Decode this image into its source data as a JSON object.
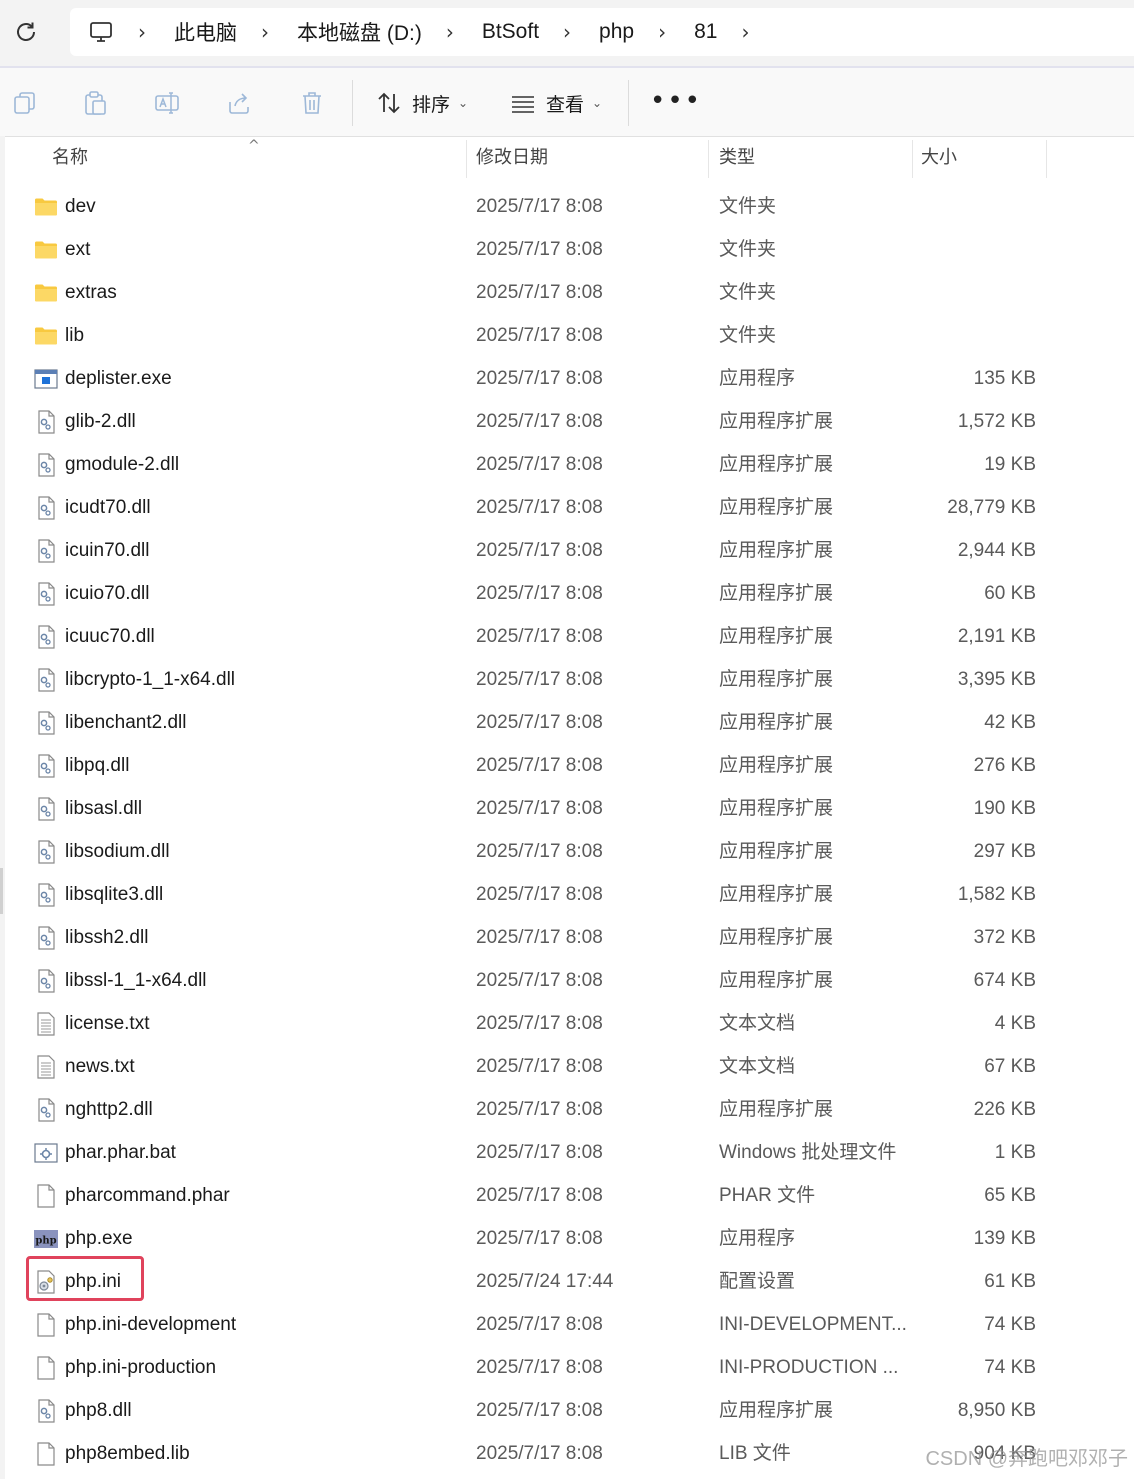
{
  "address_bar": {
    "breadcrumbs": [
      "此电脑",
      "本地磁盘 (D:)",
      "BtSoft",
      "php",
      "81"
    ],
    "separator": "›"
  },
  "toolbar": {
    "sort_label": "排序",
    "view_label": "查看",
    "more_label": "•••"
  },
  "columns": {
    "name": "名称",
    "date": "修改日期",
    "type": "类型",
    "size": "大小",
    "sort_indicator": "^"
  },
  "files": [
    {
      "name": "dev",
      "date": "2025/7/17 8:08",
      "type": "文件夹",
      "size": "",
      "icon": "folder-icon"
    },
    {
      "name": "ext",
      "date": "2025/7/17 8:08",
      "type": "文件夹",
      "size": "",
      "icon": "folder-icon"
    },
    {
      "name": "extras",
      "date": "2025/7/17 8:08",
      "type": "文件夹",
      "size": "",
      "icon": "folder-icon"
    },
    {
      "name": "lib",
      "date": "2025/7/17 8:08",
      "type": "文件夹",
      "size": "",
      "icon": "folder-icon"
    },
    {
      "name": "deplister.exe",
      "date": "2025/7/17 8:08",
      "type": "应用程序",
      "size": "135 KB",
      "icon": "exe-icon"
    },
    {
      "name": "glib-2.dll",
      "date": "2025/7/17 8:08",
      "type": "应用程序扩展",
      "size": "1,572 KB",
      "icon": "dll-icon"
    },
    {
      "name": "gmodule-2.dll",
      "date": "2025/7/17 8:08",
      "type": "应用程序扩展",
      "size": "19 KB",
      "icon": "dll-icon"
    },
    {
      "name": "icudt70.dll",
      "date": "2025/7/17 8:08",
      "type": "应用程序扩展",
      "size": "28,779 KB",
      "icon": "dll-icon"
    },
    {
      "name": "icuin70.dll",
      "date": "2025/7/17 8:08",
      "type": "应用程序扩展",
      "size": "2,944 KB",
      "icon": "dll-icon"
    },
    {
      "name": "icuio70.dll",
      "date": "2025/7/17 8:08",
      "type": "应用程序扩展",
      "size": "60 KB",
      "icon": "dll-icon"
    },
    {
      "name": "icuuc70.dll",
      "date": "2025/7/17 8:08",
      "type": "应用程序扩展",
      "size": "2,191 KB",
      "icon": "dll-icon"
    },
    {
      "name": "libcrypto-1_1-x64.dll",
      "date": "2025/7/17 8:08",
      "type": "应用程序扩展",
      "size": "3,395 KB",
      "icon": "dll-icon"
    },
    {
      "name": "libenchant2.dll",
      "date": "2025/7/17 8:08",
      "type": "应用程序扩展",
      "size": "42 KB",
      "icon": "dll-icon"
    },
    {
      "name": "libpq.dll",
      "date": "2025/7/17 8:08",
      "type": "应用程序扩展",
      "size": "276 KB",
      "icon": "dll-icon"
    },
    {
      "name": "libsasl.dll",
      "date": "2025/7/17 8:08",
      "type": "应用程序扩展",
      "size": "190 KB",
      "icon": "dll-icon"
    },
    {
      "name": "libsodium.dll",
      "date": "2025/7/17 8:08",
      "type": "应用程序扩展",
      "size": "297 KB",
      "icon": "dll-icon"
    },
    {
      "name": "libsqlite3.dll",
      "date": "2025/7/17 8:08",
      "type": "应用程序扩展",
      "size": "1,582 KB",
      "icon": "dll-icon"
    },
    {
      "name": "libssh2.dll",
      "date": "2025/7/17 8:08",
      "type": "应用程序扩展",
      "size": "372 KB",
      "icon": "dll-icon"
    },
    {
      "name": "libssl-1_1-x64.dll",
      "date": "2025/7/17 8:08",
      "type": "应用程序扩展",
      "size": "674 KB",
      "icon": "dll-icon"
    },
    {
      "name": "license.txt",
      "date": "2025/7/17 8:08",
      "type": "文本文档",
      "size": "4 KB",
      "icon": "txt-icon"
    },
    {
      "name": "news.txt",
      "date": "2025/7/17 8:08",
      "type": "文本文档",
      "size": "67 KB",
      "icon": "txt-icon"
    },
    {
      "name": "nghttp2.dll",
      "date": "2025/7/17 8:08",
      "type": "应用程序扩展",
      "size": "226 KB",
      "icon": "dll-icon"
    },
    {
      "name": "phar.phar.bat",
      "date": "2025/7/17 8:08",
      "type": "Windows 批处理文件",
      "size": "1 KB",
      "icon": "bat-icon"
    },
    {
      "name": "pharcommand.phar",
      "date": "2025/7/17 8:08",
      "type": "PHAR 文件",
      "size": "65 KB",
      "icon": "file-icon"
    },
    {
      "name": "php.exe",
      "date": "2025/7/17 8:08",
      "type": "应用程序",
      "size": "139 KB",
      "icon": "php-exe-icon"
    },
    {
      "name": "php.ini",
      "date": "2025/7/24 17:44",
      "type": "配置设置",
      "size": "61 KB",
      "icon": "ini-icon"
    },
    {
      "name": "php.ini-development",
      "date": "2025/7/17 8:08",
      "type": "INI-DEVELOPMENT...",
      "size": "74 KB",
      "icon": "file-icon"
    },
    {
      "name": "php.ini-production",
      "date": "2025/7/17 8:08",
      "type": "INI-PRODUCTION ...",
      "size": "74 KB",
      "icon": "file-icon"
    },
    {
      "name": "php8.dll",
      "date": "2025/7/17 8:08",
      "type": "应用程序扩展",
      "size": "8,950 KB",
      "icon": "dll-icon"
    },
    {
      "name": "php8embed.lib",
      "date": "2025/7/17 8:08",
      "type": "LIB 文件",
      "size": "904 KB",
      "icon": "file-icon"
    }
  ],
  "php_exe_icon_text": "php",
  "watermark": "CSDN @奔跑吧邓邓子",
  "colors": {
    "highlight": "#e0435c",
    "folder": "#f8c940",
    "toolbar_bg": "#f9f9f9",
    "address_bg": "#f3f3f3"
  }
}
